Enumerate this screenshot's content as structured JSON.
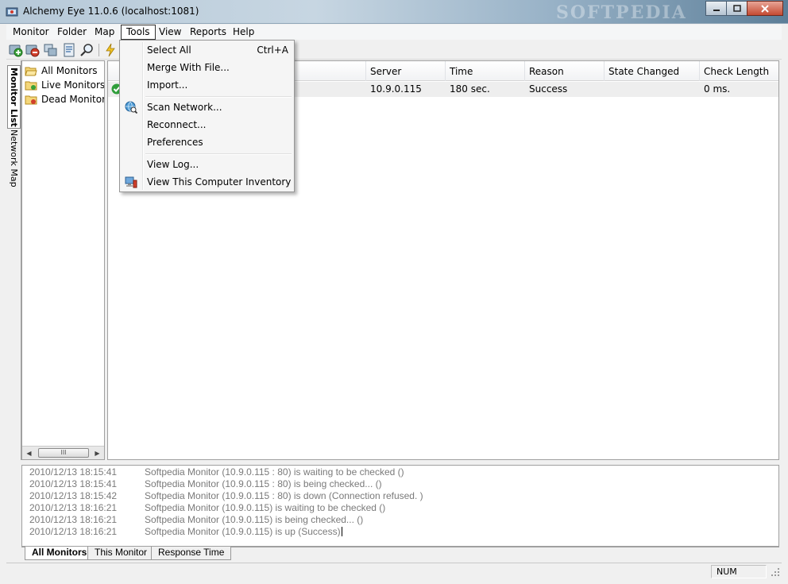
{
  "window": {
    "title": "Alchemy Eye 11.0.6 (localhost:1081)",
    "watermark": "SOFTPEDIA",
    "buttons": {
      "minimize": "minimize",
      "maximize": "maximize",
      "close": "close"
    }
  },
  "menubar": {
    "items": [
      {
        "label": "Monitor"
      },
      {
        "label": "Folder"
      },
      {
        "label": "Map"
      },
      {
        "label": "Tools"
      },
      {
        "label": "View"
      },
      {
        "label": "Reports"
      },
      {
        "label": "Help"
      }
    ]
  },
  "toolbar": {
    "buttons": [
      "add-monitor-icon",
      "delete-monitor-icon",
      "copy-monitor-icon",
      "properties-icon",
      "find-icon",
      "run-check-icon"
    ]
  },
  "vtabs": {
    "monitor_list": "Monitor List",
    "network_map": "Network Map"
  },
  "tree": {
    "items": [
      {
        "label": "All Monitors"
      },
      {
        "label": "Live Monitors"
      },
      {
        "label": "Dead Monitors"
      }
    ],
    "scroll_thumb": "III"
  },
  "list": {
    "columns": [
      "Server",
      "Time",
      "Reason",
      "State Changed",
      "Check Length"
    ],
    "rows": [
      {
        "server": "10.9.0.115",
        "time": "180 sec.",
        "reason": "Success",
        "state_changed": "",
        "check_length": "0 ms."
      }
    ]
  },
  "tools_menu": {
    "items": [
      {
        "label": "Select All",
        "shortcut": "Ctrl+A"
      },
      {
        "label": "Merge With File...",
        "shortcut": ""
      },
      {
        "label": "Import...",
        "shortcut": ""
      },
      {
        "label": "Scan Network...",
        "shortcut": ""
      },
      {
        "label": "Reconnect...",
        "shortcut": ""
      },
      {
        "label": "Preferences",
        "shortcut": ""
      },
      {
        "label": "View Log...",
        "shortcut": ""
      },
      {
        "label": "View This Computer Inventory",
        "shortcut": ""
      }
    ]
  },
  "log": {
    "lines": [
      {
        "time": "2010/12/13 18:15:41",
        "message": "Softpedia Monitor (10.9.0.115 : 80) is waiting to be checked ()"
      },
      {
        "time": "2010/12/13 18:15:41",
        "message": "Softpedia Monitor (10.9.0.115 : 80) is being checked... ()"
      },
      {
        "time": "2010/12/13 18:15:42",
        "message": "Softpedia Monitor (10.9.0.115 : 80) is down (Connection refused. )"
      },
      {
        "time": "2010/12/13 18:16:21",
        "message": "Softpedia Monitor (10.9.0.115) is waiting to be checked ()"
      },
      {
        "time": "2010/12/13 18:16:21",
        "message": "Softpedia Monitor (10.9.0.115) is being checked... ()"
      },
      {
        "time": "2010/12/13 18:16:21",
        "message": "Softpedia Monitor (10.9.0.115) is up (Success)"
      }
    ]
  },
  "bottom_tabs": [
    {
      "label": "All Monitors"
    },
    {
      "label": "This Monitor"
    },
    {
      "label": "Response Time"
    }
  ],
  "statusbar": {
    "num": "NUM"
  }
}
